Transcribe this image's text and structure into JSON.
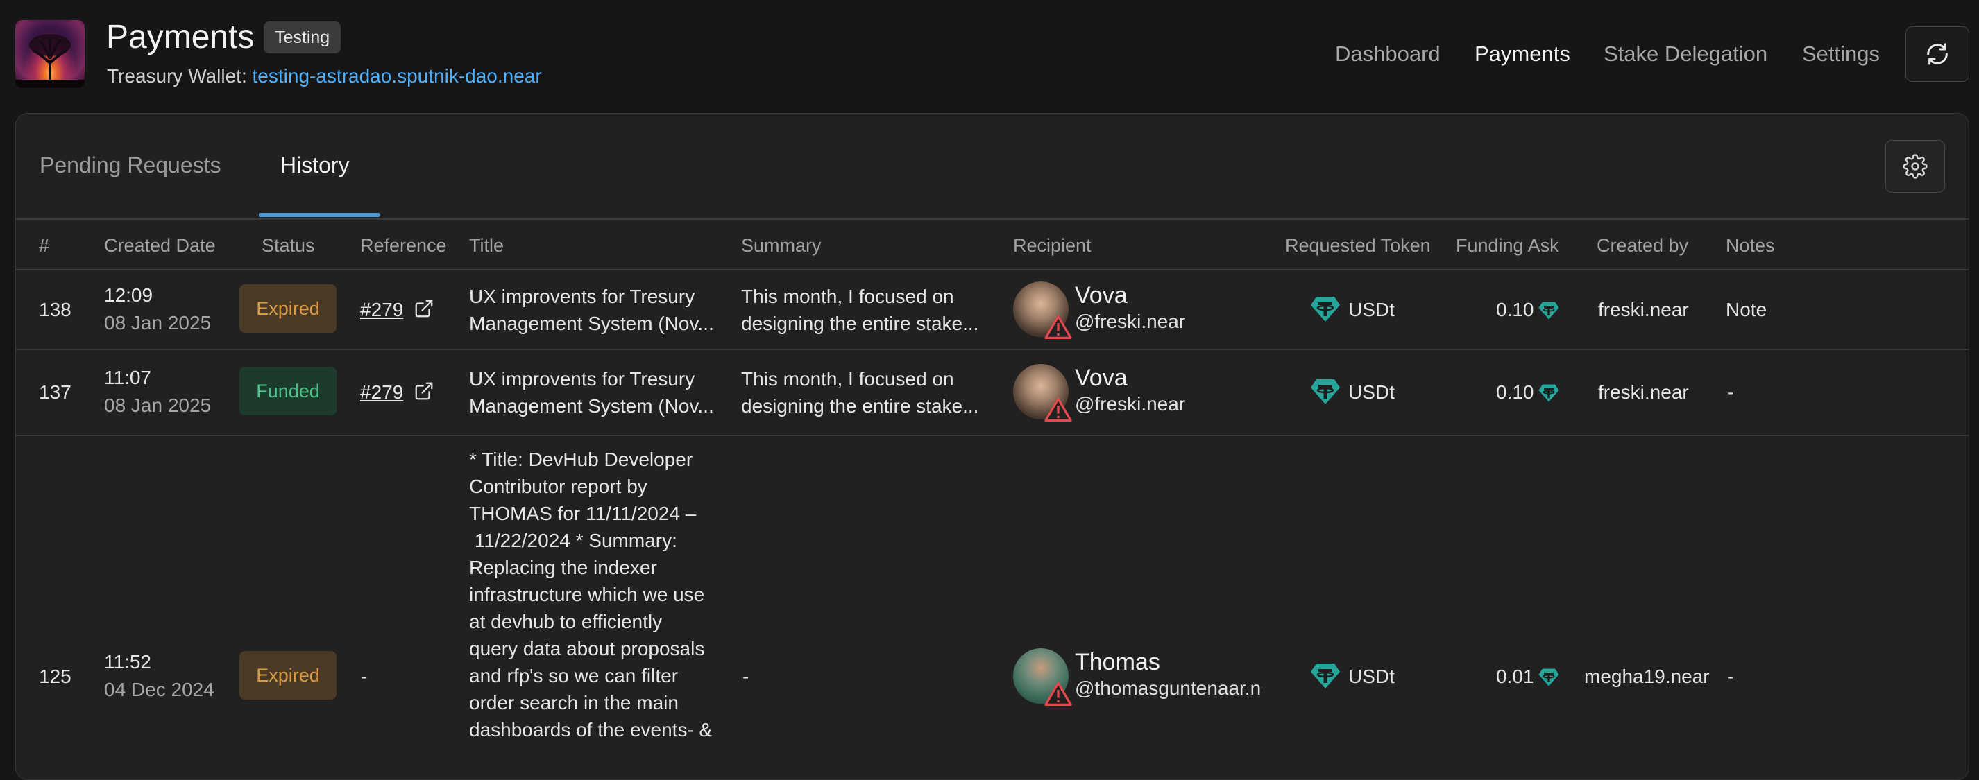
{
  "header": {
    "title": "Payments",
    "badge": "Testing",
    "wallet_label": "Treasury Wallet:",
    "wallet_address": "testing-astradao.sputnik-dao.near",
    "nav": [
      "Dashboard",
      "Payments",
      "Stake Delegation",
      "Settings"
    ],
    "active_nav": "Payments"
  },
  "tabs": {
    "pending": "Pending Requests",
    "history": "History",
    "active": "History"
  },
  "table": {
    "columns": [
      "#",
      "Created Date",
      "Status",
      "Reference",
      "Title",
      "Summary",
      "Recipient",
      "Requested Token",
      "Funding Ask",
      "Created by",
      "Notes"
    ],
    "rows": [
      {
        "id": "138",
        "time": "12:09",
        "date": "08 Jan 2025",
        "status": "Expired",
        "reference": "#279",
        "title_lines": [
          "UX improvents for Tresury",
          "Management System (Nov..."
        ],
        "summary_lines": [
          "This month, I focused on",
          "designing the entire stake..."
        ],
        "recipient_name": "Vova",
        "recipient_handle": "@freski.near",
        "token": "USDt",
        "amount": "0.10",
        "created_by": "freski.near",
        "notes": "Note"
      },
      {
        "id": "137",
        "time": "11:07",
        "date": "08 Jan 2025",
        "status": "Funded",
        "reference": "#279",
        "title_lines": [
          "UX improvents for Tresury",
          "Management System (Nov..."
        ],
        "summary_lines": [
          "This month, I focused on",
          "designing the entire stake..."
        ],
        "recipient_name": "Vova",
        "recipient_handle": "@freski.near",
        "token": "USDt",
        "amount": "0.10",
        "created_by": "freski.near",
        "notes": "-"
      },
      {
        "id": "125",
        "time": "11:52",
        "date": "04 Dec 2024",
        "status": "Expired",
        "reference": "-",
        "title_lines": [
          "* Title: DevHub Developer",
          "Contributor report by",
          "THOMAS for 11/11/2024 –",
          " 11/22/2024 * Summary:",
          "Replacing the indexer",
          "infrastructure which we use",
          "at devhub to efficiently",
          "query data about proposals",
          "and rfp's so we can filter",
          "order search in the main",
          "dashboards of the events- &"
        ],
        "summary": "-",
        "recipient_name": "Thomas",
        "recipient_handle": "@thomasguntenaar.near",
        "token": "USDt",
        "amount": "0.01",
        "created_by": "megha19.near",
        "notes": "-"
      }
    ]
  },
  "icons": {
    "refresh": "refresh-icon",
    "settings": "gear-icon",
    "external_link": "external-link-icon",
    "warning": "warning-icon",
    "token": "tether-icon"
  },
  "colors": {
    "accent": "#4e9ad6",
    "link": "#4fb0ff",
    "expired": "#d99a43",
    "funded": "#4cc289",
    "tether": "#26a69a",
    "warning": "#e5484d"
  }
}
